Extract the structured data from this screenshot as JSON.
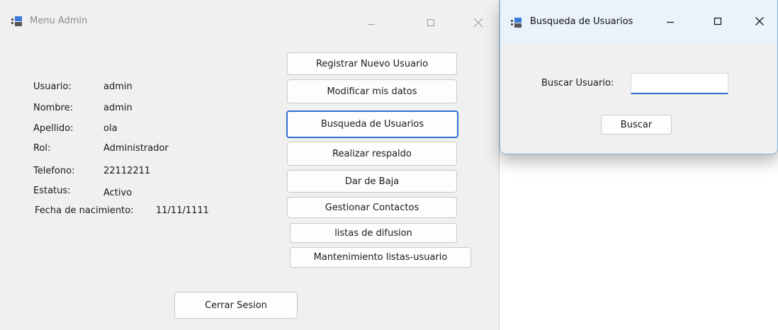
{
  "admin_window": {
    "title": "Menu Admin",
    "fields": [
      {
        "label": "Usuario:",
        "value": "admin"
      },
      {
        "label": "Nombre:",
        "value": "admin"
      },
      {
        "label": "Apellido:",
        "value": "ola"
      },
      {
        "label": "Rol:",
        "value": "Administrador"
      },
      {
        "label": "Telefono:",
        "value": "22112211"
      },
      {
        "label": "Estatus:",
        "value": "Activo"
      },
      {
        "label": "Fecha de nacimiento:",
        "value": "11/11/1111"
      }
    ],
    "buttons": [
      "Registrar Nuevo Usuario",
      "Modificar mis datos",
      "Busqueda de Usuarios",
      "Realizar respaldo",
      "Dar de Baja",
      "Gestionar Contactos",
      "listas de difusion",
      "Mantenimiento listas-usuario"
    ],
    "logout_label": "Cerrar Sesion"
  },
  "search_window": {
    "title": "Busqueda de Usuarios",
    "search_label": "Buscar Usuario:",
    "search_value": "",
    "search_button": "Buscar"
  },
  "colors": {
    "accent": "#2e6fd1",
    "window_bg": "#f0f0f0",
    "search_titlebar_bg": "#eaf2fb"
  },
  "icons": {
    "app": "app-window-icon",
    "minimize": "minimize-icon",
    "maximize": "maximize-icon",
    "close": "close-icon"
  }
}
